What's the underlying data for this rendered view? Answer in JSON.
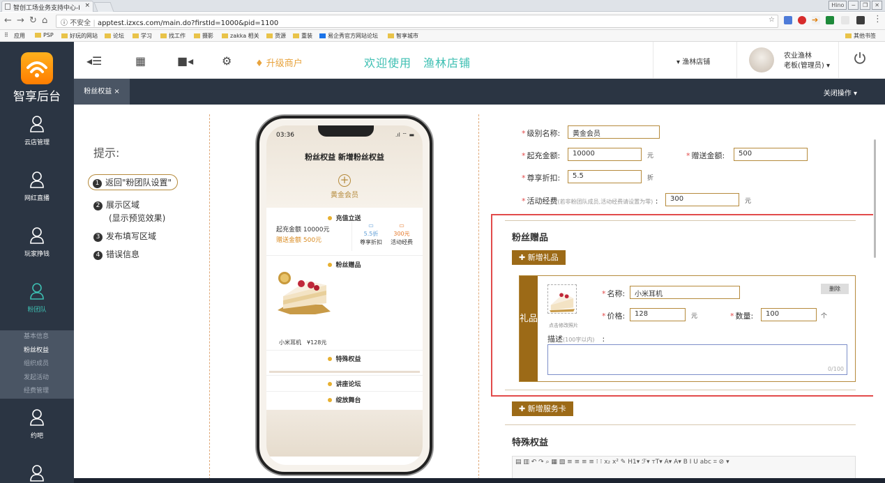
{
  "browser": {
    "tab_title": "智创工场业务支持中心-I",
    "window_user": "Hino",
    "insecure_label": "不安全",
    "url": "apptest.izxcs.com/main.do?firstId=1000&pid=1100",
    "bookmarks": [
      "应用",
      "PSP",
      "好玩的网站",
      "论坛",
      "学习",
      "找工作",
      "摄影",
      "zakka 相关",
      "货源",
      "重装",
      "易企秀官方网站论坛",
      "智享城市"
    ],
    "other_bookmarks": "其他书签"
  },
  "sidebar": {
    "logo_text": "智享后台",
    "items": [
      {
        "label": "云店管理"
      },
      {
        "label": "网红直播"
      },
      {
        "label": "玩家挣钱"
      },
      {
        "label": "粉团队"
      },
      {
        "label": "约吧"
      }
    ],
    "submenu": [
      "基本信息",
      "粉丝权益",
      "组织成员",
      "发起活动",
      "经费管理"
    ]
  },
  "topbar": {
    "upgrade_label": "升级商户",
    "welcome": "欢迎使用　渔林店铺",
    "store_select": "渔林店铺",
    "user_name": "农业渔林",
    "user_role": "老板(管理员)"
  },
  "page_tabs": {
    "active": "粉丝权益 ×",
    "close_ops": "关闭操作"
  },
  "tips": {
    "title": "提示:",
    "items": [
      "返回\"粉团队设置\"",
      "展示区域",
      "(显示预览效果)",
      "发布填写区域",
      "错误信息"
    ]
  },
  "phone": {
    "time": "03:36",
    "title": "粉丝权益 新增粉丝权益",
    "level": "黄金会员",
    "recharge_title": "充值立送",
    "recharge_amount": "起充金额 10000元",
    "gift_amount": "赠送金额 500元",
    "discount_val": "5.5折",
    "discount_lbl": "尊享折扣",
    "fund_val": "300元",
    "fund_lbl": "活动经费",
    "gift_section": "粉丝赠品",
    "gift_name": "小米耳机",
    "gift_price": "¥128元",
    "special": "特殊权益",
    "forum": "讲座论坛",
    "stage": "绽放舞台"
  },
  "form": {
    "level_label": "级别名称:",
    "level_value": "黄金会员",
    "start_label": "起充金额:",
    "start_value": "10000",
    "yuan": "元",
    "bonus_label": "赠送金额:",
    "bonus_value": "500",
    "discount_label": "尊享折扣:",
    "discount_value": "5.5",
    "zhe": "折",
    "fund_label": "活动经费",
    "fund_hint": "(若非粉团队成员,活动经费请设置为零)",
    "fund_colon": ":",
    "fund_value": "300",
    "gift_title": "粉丝赠品",
    "add_gift": "新增礼品",
    "gift_side": "礼品",
    "name_label": "名称:",
    "name_value": "小米耳机",
    "delete": "删除",
    "photo_hint": "点击修改照片",
    "price_label": "价格:",
    "price_value": "128",
    "qty_label": "数量:",
    "qty_value": "100",
    "ge": "个",
    "desc_label": "描述",
    "desc_hint": "(100字以内)",
    "desc_colon": ":",
    "desc_count": "0/100",
    "add_card": "新增服务卡",
    "special_title": "特殊权益"
  },
  "colors": {
    "sidebar": "#2b3543",
    "accent": "#3dbfb2",
    "brown": "#9c6a17",
    "error": "#e24a4a"
  }
}
